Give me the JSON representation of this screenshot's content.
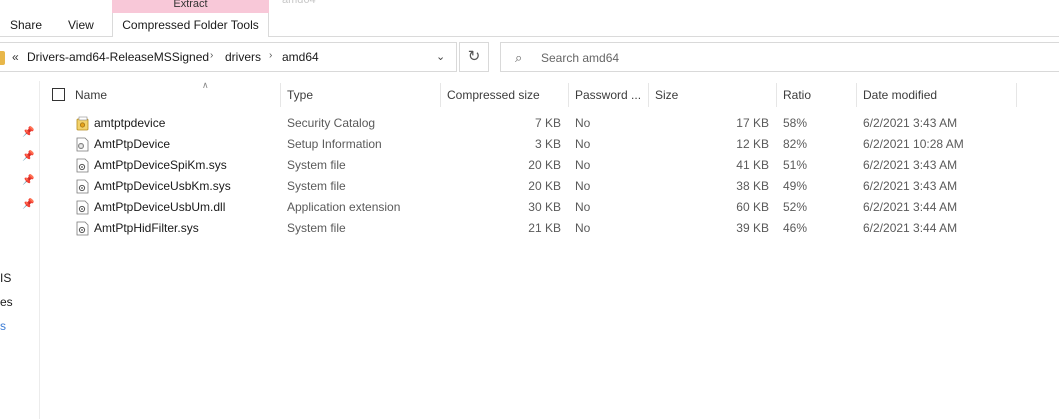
{
  "ribbon": {
    "share": "Share",
    "view": "View",
    "context_group_label": "Extract",
    "context_tab": "Compressed Folder Tools",
    "window_title_fragment": "amd64"
  },
  "address": {
    "prefix": "«",
    "crumbs": [
      "Drivers-amd64-ReleaseMSSigned",
      "drivers",
      "amd64"
    ]
  },
  "search": {
    "placeholder": "Search amd64"
  },
  "nav": {
    "fragments": [
      "IS",
      "es",
      "s"
    ]
  },
  "columns": {
    "name": "Name",
    "type": "Type",
    "compressed_size": "Compressed size",
    "password": "Password ...",
    "size": "Size",
    "ratio": "Ratio",
    "date_modified": "Date modified"
  },
  "files": [
    {
      "name": "amtptpdevice",
      "type": "Security Catalog",
      "compressed": "7 KB",
      "password": "No",
      "size": "17 KB",
      "ratio": "58%",
      "date": "6/2/2021 3:43 AM",
      "icon": "catalog-icon"
    },
    {
      "name": "AmtPtpDevice",
      "type": "Setup Information",
      "compressed": "3 KB",
      "password": "No",
      "size": "12 KB",
      "ratio": "82%",
      "date": "6/2/2021 10:28 AM",
      "icon": "setup-info-icon"
    },
    {
      "name": "AmtPtpDeviceSpiKm.sys",
      "type": "System file",
      "compressed": "20 KB",
      "password": "No",
      "size": "41 KB",
      "ratio": "51%",
      "date": "6/2/2021 3:43 AM",
      "icon": "system-file-icon"
    },
    {
      "name": "AmtPtpDeviceUsbKm.sys",
      "type": "System file",
      "compressed": "20 KB",
      "password": "No",
      "size": "38 KB",
      "ratio": "49%",
      "date": "6/2/2021 3:43 AM",
      "icon": "system-file-icon"
    },
    {
      "name": "AmtPtpDeviceUsbUm.dll",
      "type": "Application extension",
      "compressed": "30 KB",
      "password": "No",
      "size": "60 KB",
      "ratio": "52%",
      "date": "6/2/2021 3:44 AM",
      "icon": "dll-file-icon"
    },
    {
      "name": "AmtPtpHidFilter.sys",
      "type": "System file",
      "compressed": "21 KB",
      "password": "No",
      "size": "39 KB",
      "ratio": "46%",
      "date": "6/2/2021 3:44 AM",
      "icon": "system-file-icon"
    }
  ],
  "colors": {
    "context_tab_accent": "#f8c8d8",
    "nav_link": "#3a7bd5"
  }
}
